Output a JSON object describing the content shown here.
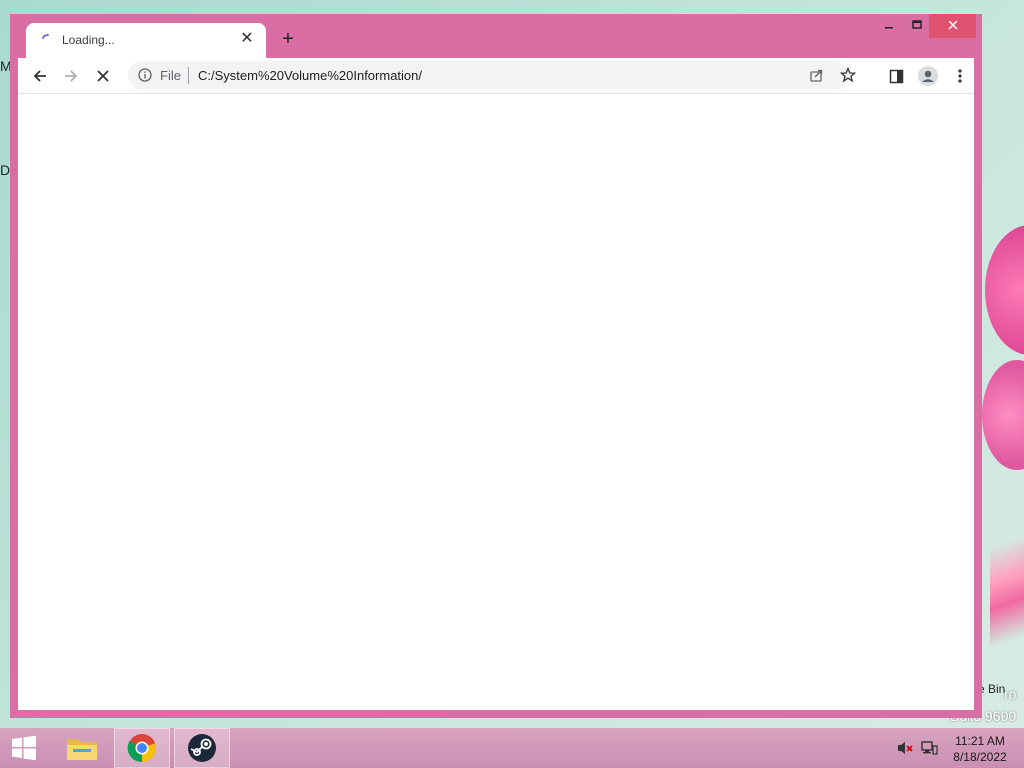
{
  "browser": {
    "tab": {
      "title": "Loading..."
    },
    "address_bar": {
      "scheme": "File",
      "url": "C:/System%20Volume%20Information/"
    }
  },
  "desktop": {
    "left_labels": [
      "M",
      "D"
    ],
    "right_labels": [
      "e Bin",
      "ro",
      "Build 9600"
    ]
  },
  "taskbar": {
    "apps": [
      "start-icon",
      "file-explorer-icon",
      "chrome-icon",
      "steam-icon"
    ],
    "clock": {
      "time": "11:21 AM",
      "date": "8/18/2022"
    }
  },
  "colors": {
    "window_frame": "#d96ea4",
    "close_button": "#e0506f",
    "taskbar": "#c98fb2"
  }
}
